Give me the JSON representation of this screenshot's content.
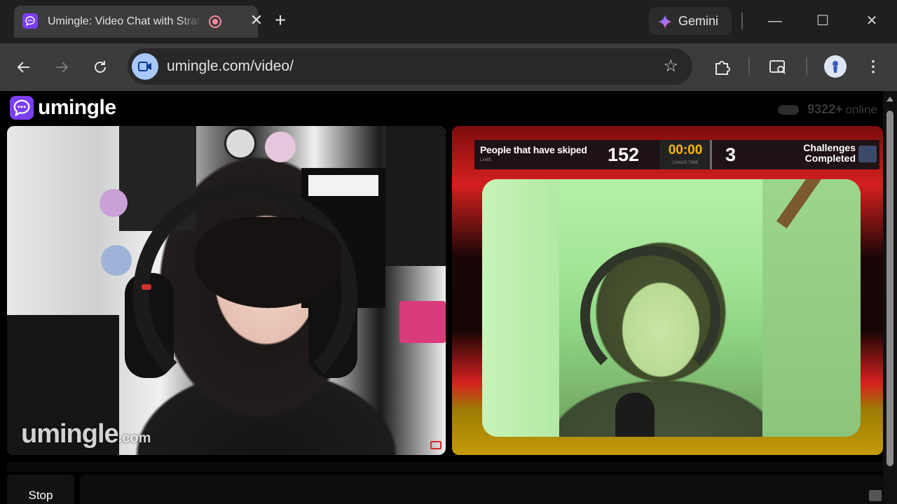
{
  "browser": {
    "tab_title": "Umingle: Video Chat with Strangers",
    "gemini_label": "Gemini",
    "url": "umingle.com/video/"
  },
  "page": {
    "logo_text": "umingle",
    "online_count": "9322+",
    "online_word": "online",
    "watermark_main": "umingle",
    "watermark_suffix": ".com",
    "stop_label": "Stop"
  },
  "scoreboard": {
    "skipped_label": "People that have skiped",
    "skipped_sub": "LAME",
    "skipped_count": "152",
    "timer": "00:00",
    "timer_sub": "CHAOS TIME",
    "challenges_count": "3",
    "challenges_label_line1": "Challenges",
    "challenges_label_line2": "Completed"
  },
  "colors": {
    "brand": "#7b3ff2",
    "timer": "#f5b800",
    "recording": "#f28b9b"
  }
}
